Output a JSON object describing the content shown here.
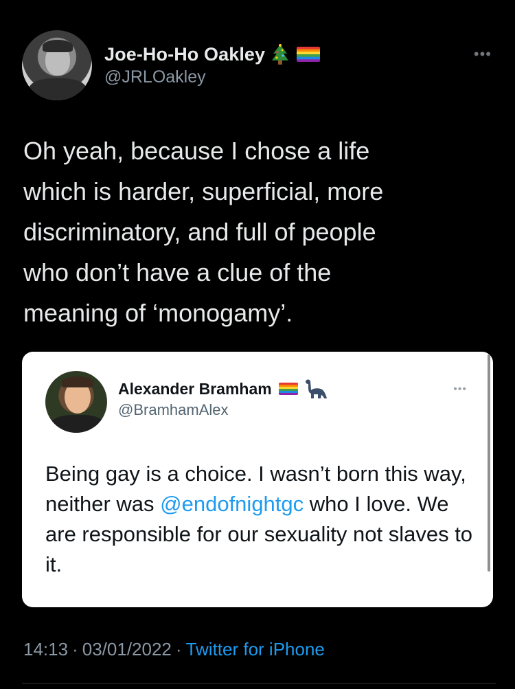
{
  "tweet": {
    "author": {
      "display_name": "Joe-Ho-Ho Oakley",
      "handle": "@JRLOakley",
      "emojis": [
        "christmas-tree-icon",
        "rainbow-flag-icon"
      ]
    },
    "more_icon": "more-icon",
    "text": "Oh yeah, because I chose a life\nwhich is harder, superficial, more\ndiscriminatory, and full of people\nwho don’t have a clue of the\nmeaning of ‘monogamy’.",
    "time": "14:13",
    "date": "03/01/2022",
    "separator": "·",
    "source": "Twitter for iPhone"
  },
  "quote": {
    "author": {
      "display_name": "Alexander Bramham",
      "handle": "@BramhamAlex",
      "emojis": [
        "rainbow-flag-icon",
        "dinosaur-icon"
      ]
    },
    "text_before": "Being gay is a choice. I wasn’t born this way, neither was ",
    "mention": "@endofnightgc",
    "text_after": " who I love. We are responsible for our sexuality not slaves to it."
  },
  "colors": {
    "background": "#000000",
    "text": "#e7e9ea",
    "secondary": "#8b98a5",
    "link": "#1d9bf0",
    "card_background": "#ffffff"
  }
}
